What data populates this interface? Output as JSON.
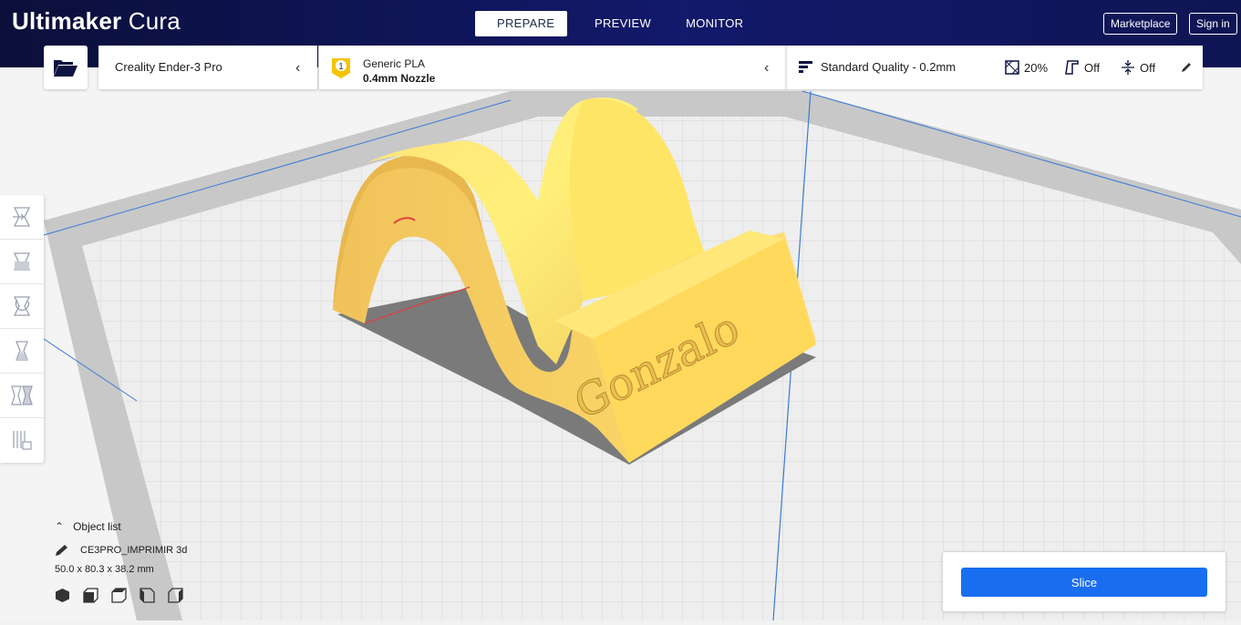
{
  "app": {
    "logo_bold": "Ultimaker",
    "logo_light": "Cura"
  },
  "stages": [
    {
      "label": "PREPARE",
      "active": true
    },
    {
      "label": "PREVIEW",
      "active": false
    },
    {
      "label": "MONITOR",
      "active": false
    }
  ],
  "header_buttons": {
    "marketplace": "Marketplace",
    "sign_in": "Sign in"
  },
  "machine": {
    "name": "Creality Ender-3 Pro"
  },
  "material": {
    "extruder_number": "1",
    "name": "Generic PLA",
    "nozzle": "0.4mm Nozzle"
  },
  "print_settings": {
    "profile": "Standard Quality - 0.2mm",
    "infill": "20%",
    "support": "Off",
    "adhesion": "Off"
  },
  "left_tools": [
    "move-tool-icon",
    "scale-tool-icon",
    "rotate-tool-icon",
    "mirror-tool-icon",
    "per-model-settings-icon",
    "support-blocker-icon"
  ],
  "object_list": {
    "header": "Object list",
    "object_name": "CE3PRO_IMPRIMIR 3d",
    "dimensions": "50.0 x 80.3 x 38.2 mm"
  },
  "model": {
    "embossed_text": "Gonzalo"
  },
  "slice": {
    "button_label": "Slice"
  },
  "colors": {
    "header_dark": "#0b0f3a",
    "header_mid": "#13196b",
    "accent_blue": "#196ef0",
    "model_yellow": "#ffe56b",
    "plate_light": "#f3f3f3",
    "plate_border": "#c9c9c9"
  }
}
